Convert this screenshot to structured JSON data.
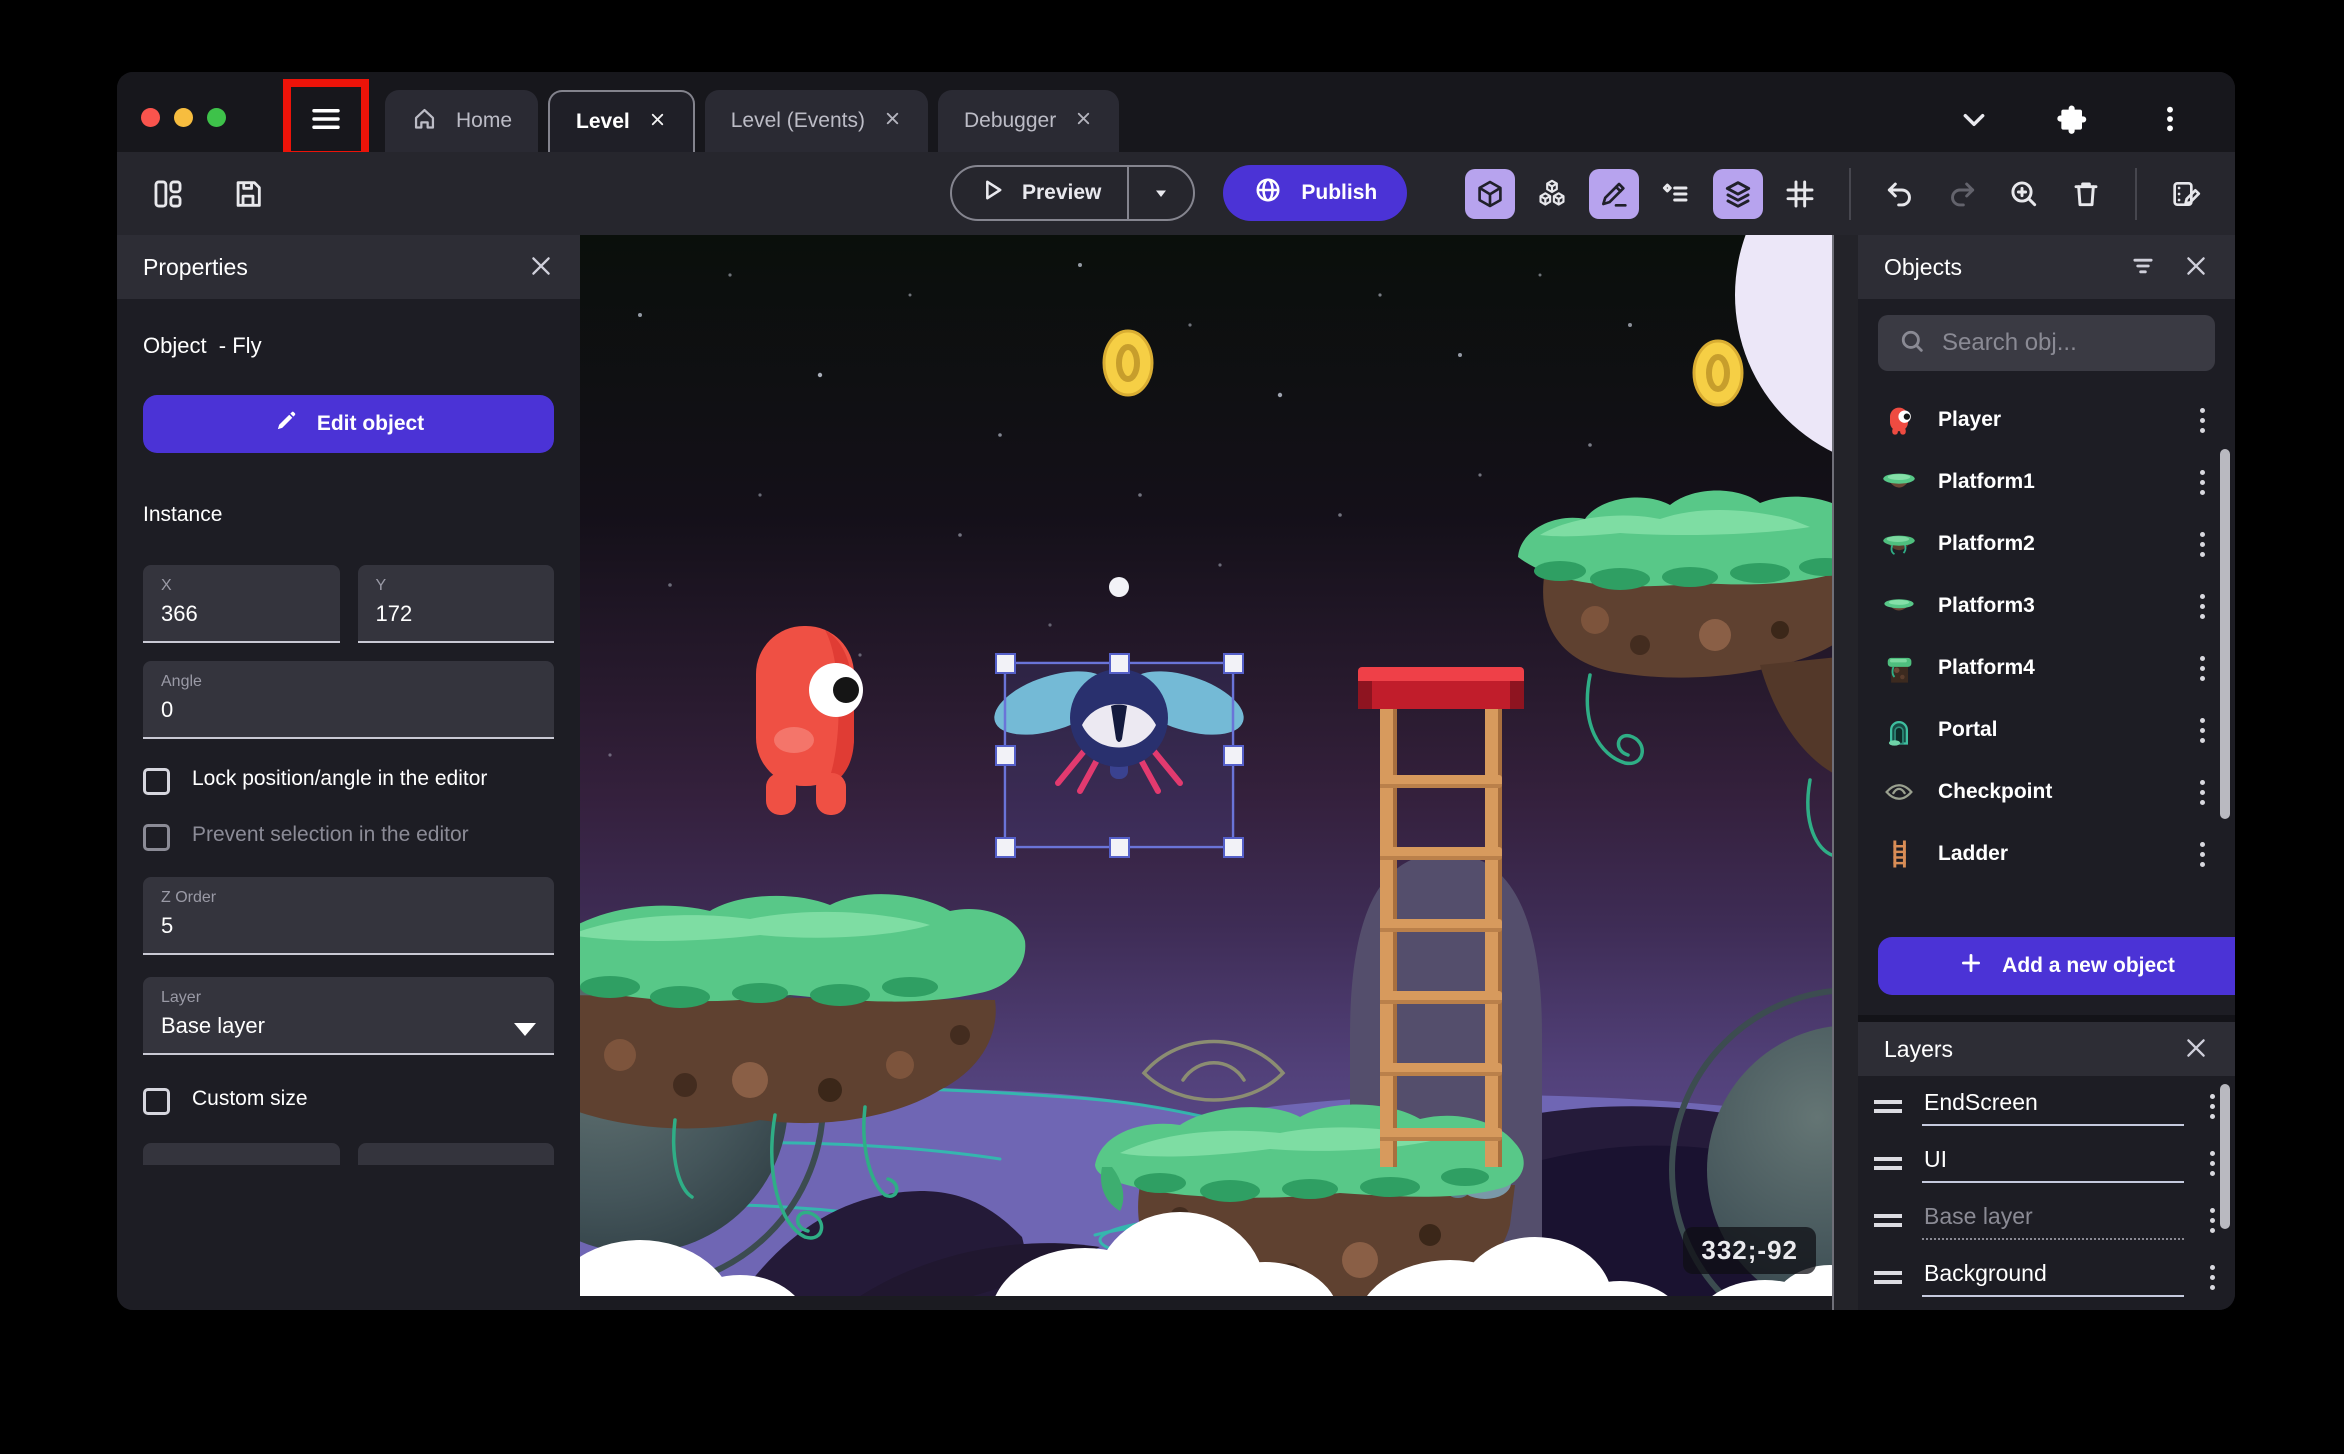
{
  "window": {
    "tabs": [
      {
        "label": "Home"
      },
      {
        "label": "Level"
      },
      {
        "label": "Level (Events)"
      },
      {
        "label": "Debugger"
      }
    ]
  },
  "toolbar": {
    "preview_label": "Preview",
    "publish_label": "Publish"
  },
  "properties_panel": {
    "title": "Properties",
    "object_heading": "Object  - Fly",
    "edit_object_label": "Edit object",
    "instance_heading": "Instance",
    "x_label": "X",
    "x_value": "366",
    "y_label": "Y",
    "y_value": "172",
    "angle_label": "Angle",
    "angle_value": "0",
    "lock_label": "Lock position/angle in the editor",
    "prevent_label": "Prevent selection in the editor",
    "z_order_label": "Z Order",
    "z_order_value": "5",
    "layer_label": "Layer",
    "layer_value": "Base layer",
    "custom_size_label": "Custom size"
  },
  "objects_panel": {
    "title": "Objects",
    "search_placeholder": "Search obj...",
    "items": [
      {
        "name": "Player"
      },
      {
        "name": "Platform1"
      },
      {
        "name": "Platform2"
      },
      {
        "name": "Platform3"
      },
      {
        "name": "Platform4"
      },
      {
        "name": "Portal"
      },
      {
        "name": "Checkpoint"
      },
      {
        "name": "Ladder"
      }
    ],
    "add_button_label": "Add a new object"
  },
  "layers_panel": {
    "title": "Layers",
    "layers": [
      {
        "name": "EndScreen"
      },
      {
        "name": "UI"
      },
      {
        "name": "Base layer",
        "active": true
      },
      {
        "name": "Background"
      }
    ]
  },
  "canvas": {
    "coordinates": "332;-92"
  },
  "colors": {
    "accent": "#4b33d6",
    "toolbar_active_bg": "#b7a3ee",
    "selection": "#6a74d8",
    "annotation": "#ec1309"
  }
}
